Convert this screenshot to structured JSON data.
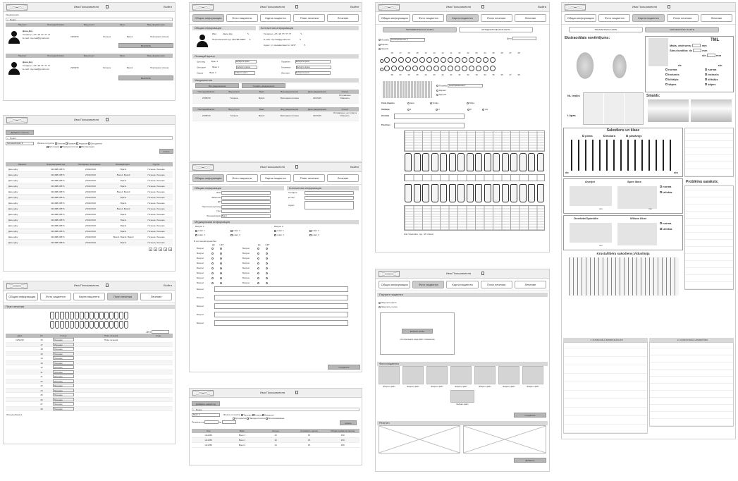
{
  "app": {
    "user": "Имя Пользователя",
    "exit": "Выйти",
    "logo": "logo"
  },
  "tabs": [
    "Общая информация",
    "Фото пациента",
    "Карта пациента",
    "План лечения",
    "Лечение"
  ],
  "p1": {
    "section_notes": "Уведомления",
    "search": "Поиск",
    "headers": [
      "Пациент",
      "Последний визит",
      "Вид услуги",
      "Врач",
      "Вид уведомления"
    ],
    "patient": {
      "name": "Джон Доу",
      "phone_label": "Телефон:",
      "phone": "+371 26 777 77 77",
      "email_label": "E-mail:",
      "email": "myemail@gmail.com",
      "visit": "23/08/16",
      "service": "Гигиена",
      "doctor": "Врач1",
      "notice": "Повторная гигиена"
    },
    "btn": "ВЫСЛАТЬ"
  },
  "p2": {
    "add_btn": "Добавить клиента",
    "search": "Поиск",
    "filter": "Лечащий врач",
    "opts": [
      "Искать по группе:",
      "Гигиена",
      "Терапия",
      "Хирургия",
      "Ортодонтия",
      "Ортопедия",
      "Пародонтология",
      "Имплантация",
      "Гнатология",
      "Протезирование"
    ],
    "search_btn": "искать",
    "headers": [
      "Пациент",
      "Персональный код",
      "Последнее посещение",
      "Лечащий врач",
      "Группа"
    ],
    "rows": [
      [
        "Джон Доу",
        "010488-00874",
        "23/02/2016",
        "Врач1",
        "Гигиена, Лечение"
      ],
      [
        "Джон Доу",
        "010488-00874",
        "23/02/2016",
        "Врач1, Врач3",
        "Гигиена, Лечение"
      ],
      [
        "Джон Доу",
        "010488-00874",
        "23/02/2016",
        "Врач1",
        "Гигиена, Лечение"
      ],
      [
        "Джон Доу",
        "010488-00874",
        "23/02/2016",
        "Врач1",
        "Гигиена, Лечение"
      ],
      [
        "Джон Доу",
        "010488-00874",
        "23/02/2016",
        "Врач1, Врач3",
        "Гигиена, Лечение"
      ],
      [
        "Джон Доу",
        "010488-00874",
        "23/02/2016",
        "Врач1",
        "Гигиена, Лечение"
      ],
      [
        "Джон Доу",
        "010488-00874",
        "23/02/2016",
        "Врач1",
        "Гигиена, Лечение"
      ],
      [
        "Джон Доу",
        "010488-00874",
        "23/02/2016",
        "Врач1, Врач2",
        "Гигиена, Лечение"
      ],
      [
        "Джон Доу",
        "010488-00874",
        "23/02/2016",
        "Врач1",
        "Гигиена, Лечение"
      ],
      [
        "Джон Доу",
        "010488-00874",
        "23/02/2016",
        "Врач1",
        "Гигиена, Лечение"
      ],
      [
        "Джон Доу",
        "010488-00874",
        "23/02/2016",
        "Врач1",
        "Гигиена, Лечение"
      ],
      [
        "Джон Доу",
        "010488-00874",
        "23/02/2016",
        "Врач1",
        "Гигиена, Лечение"
      ],
      [
        "Джон Доу",
        "010488-00874",
        "23/02/2016",
        "Врач1, Врач2, Врач3",
        "Гигиена, Лечение"
      ],
      [
        "Джон Доу",
        "010488-00874",
        "23/02/2016",
        "Врач1",
        "Гигиена, Лечение"
      ]
    ],
    "pages": [
      "1",
      "2",
      "3",
      "4",
      "5"
    ]
  },
  "p3": {
    "section": "План лечения",
    "date_label": "Дата",
    "headers": [
      "Дата",
      "№",
      "Статус",
      "План лечения",
      "Коды"
    ],
    "date": "12/02/16",
    "nums": [
      "16",
      "17",
      "18",
      "15",
      "14",
      "13",
      "12",
      "11",
      "21",
      "22",
      "23",
      "24",
      "25",
      "26",
      "27",
      "28"
    ],
    "status": "Лечение",
    "plan": "План лечения",
    "footer": "Лечение/Анкета"
  },
  "p4": {
    "sec_general": "Общая информация",
    "sec_contact": "Контактная информация",
    "name_label": "Имя:",
    "name": "Джон Доу",
    "code_label": "Персональный код:",
    "code": "010788-00887",
    "phone_label": "Телефон:",
    "phone": "+371 26 777 77 77",
    "email_label": "E-mail:",
    "email": "myemail@gmail.com",
    "addr_label": "Адрес:",
    "addr": "ул. Независимости, 10/17",
    "sec_doctors": "Лечащий врачи",
    "doctors": [
      [
        "Ортопед",
        "Врач 1"
      ],
      [
        "Ортодонт",
        "Врач 2"
      ],
      [
        "Хирург",
        "Врач 3"
      ]
    ],
    "doctors_r": [
      [
        "Терапевт",
        "Выберите врача"
      ],
      [
        "Гигиенист",
        "Выберите врача"
      ],
      [
        "Имплант.",
        "Выберите врача"
      ]
    ],
    "pick": "выберите врача",
    "sec_notes": "Уведомления",
    "btn_all": "Все уведомления",
    "btn_create": "Создать уведомление",
    "headers": [
      "Последний визит",
      "Вид услуги",
      "Врач",
      "Вид уведомления",
      "Дата уведомления",
      "Статус"
    ],
    "row": [
      "23/08/16",
      "Гигиена",
      "Врач1",
      "Повторная гигиена",
      "23/10/16"
    ],
    "status1": "Отправлено",
    "edit": "Изменить",
    "status2": "Отправлено, нет ответа"
  },
  "p5": {
    "sec_general": "Общая информация",
    "sec_contact": "Контактная информация",
    "fields": [
      "Имя",
      "Фамилия",
      "ДР",
      "Персональный код",
      "Пол",
      "Лечащий врач"
    ],
    "fields_r": [
      "Телефон",
      "E-mail",
      "Адрес"
    ],
    "doctor": "Врач1",
    "sec_med": "Медицинская информация",
    "q1": "Вопрос 1",
    "q2": "Вопрос 2",
    "answers": [
      "ответ 1",
      "ответ 2",
      "ответ 3",
      "ответ 4"
    ],
    "sec_state": "В состоянии время Вы:",
    "yes": "Да",
    "no": "НЕТ",
    "q": "Вопрос",
    "save": "Сохранить"
  },
  "p6": {
    "add_btn": "Добавить новый год",
    "search": "Поиск",
    "filter": "Врач",
    "opts": [
      "Искать по группе:",
      "Терапия",
      "Гигиена",
      "Хирургия",
      "Ортодонтия",
      "Пародонтология",
      "Протезирование"
    ],
    "period": "Промежуток",
    "to": "до",
    "search_btn": "искать",
    "headers": [
      "Код",
      "Врач",
      "Кол-во",
      "Стоимость одного",
      "Общая сумма за период"
    ],
    "rows": [
      [
        "H11456",
        "Врач 1",
        "10",
        "15",
        "150"
      ],
      [
        "H11456",
        "Врач 1",
        "10",
        "15",
        "150"
      ],
      [
        "H11456",
        "Врач 2",
        "14",
        "15",
        "180"
      ]
    ]
  },
  "p7": {
    "tab1": "ТЕРАПЕВТИЧЕСКАЯ КАРТА",
    "tab2": "ОРТОДОНТИЧЕСКАЯ КАРТА",
    "date_label": "Дата",
    "r1": "Пломба",
    "r2": "Кариес",
    "r3": "Здоров",
    "sel": "декабрёванная",
    "nums_top": [
      "18",
      "17",
      "16",
      "15",
      "14",
      "13",
      "12",
      "11",
      "21",
      "22",
      "23",
      "24",
      "25",
      "26",
      "27",
      "28"
    ],
    "nums_bot": [
      "48",
      "47",
      "46",
      "45",
      "44",
      "43",
      "42",
      "41",
      "31",
      "32",
      "33",
      "34",
      "35",
      "36",
      "37",
      "38"
    ],
    "o": "O",
    "fields": [
      "Cieta lūgums",
      "Oklūzija",
      "Glotāda",
      "Piezīmes"
    ],
    "opts": [
      "Iaba",
      "Viduja",
      "Slikta"
    ],
    "legend": "Zobs Tuberkulāris",
    "l2": "Ilgs",
    "l3": "NN: Izolaturi"
  },
  "p8": {
    "section": "Портрет пациента",
    "opt1": "Загрузить фото",
    "opt2": "Загрузить полое",
    "pick": "Выбрать файл",
    "drop": "или перетащите сюда файл с компьютера",
    "sec_photo": "Фото пациента",
    "pick_small": "Выбрать файл",
    "save": "Сохранить",
    "sec_xray": "Рентген",
    "add": "Добавить"
  },
  "p9": {
    "tab1": "TERAPEITISKA KARTE",
    "tab2": "ORTODONTISKA KARTE",
    "extra": "Ekstraorālais novērtējums:",
    "tml": "TML",
    "tml_lines": [
      "Maks. atvērums:",
      "Sānu kustība:",
      "dx",
      "sin"
    ],
    "mm": "mm",
    "tml_list": [
      "norma",
      "troksnis",
      "klikšķis",
      "sāpes"
    ],
    "dx": "dx",
    "sin": "sin",
    "nl": "NL leņķis",
    "lupas": "Lūpas",
    "smaids": "Smaids:",
    "sakod": "Sakodiens un klase",
    "plena": "plena",
    "molara": "molara",
    "pastavigs": "pastāvīgs",
    "prob": "Problēmu saraksts:",
    "overjet": "Overjet",
    "spee": "Spee līkne",
    "norma": "norma",
    "izlikta": "izliekta",
    "overbite": "Overbite/Openbite",
    "wilson": "Wilson līkne",
    "krusta": "Krusta/lībēru sakodiens;Vidusliņija",
    "sec1": "1. FUNKCIJĀLĀ MANIPULĀCIJAS",
    "sec2": "2. FUNKCIONĀLĀ APARATŪRA",
    "n": "N"
  }
}
